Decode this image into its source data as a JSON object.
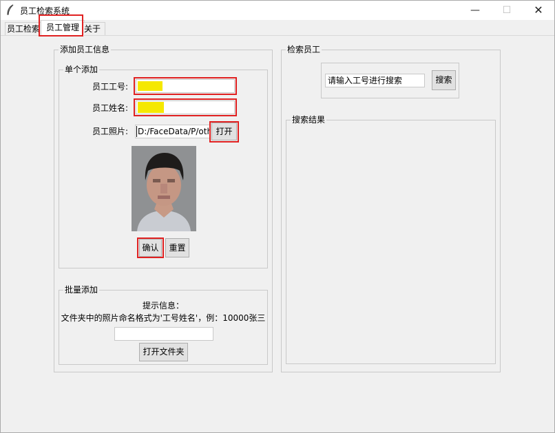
{
  "window": {
    "title": "员工检索系统",
    "app_icon": "feather-icon",
    "controls": {
      "minimize": "—",
      "maximize": "☐",
      "close": "✕"
    }
  },
  "tabs": [
    {
      "label": "员工检索"
    },
    {
      "label": "员工管理",
      "selected": true
    },
    {
      "label": "关于"
    }
  ],
  "add_section": {
    "title": "添加员工信息",
    "single": {
      "title": "单个添加",
      "id_label": "员工工号:",
      "id_value": "",
      "name_label": "员工姓名:",
      "name_value": "",
      "photo_label": "员工照片:",
      "photo_path": "D:/FaceData/P/oth",
      "open_button": "打开",
      "confirm_button": "确认",
      "reset_button": "重置"
    },
    "batch": {
      "title": "批量添加",
      "hint_title": "提示信息：",
      "hint_text": "文件夹中的照片命名格式为'工号姓名'，例：10000张三",
      "folder_value": "",
      "open_folder_button": "打开文件夹"
    }
  },
  "search_section": {
    "title": "检索员工",
    "search_value": "请输入工号进行搜索",
    "search_button": "搜索",
    "results_title": "搜索结果",
    "results": []
  },
  "colors": {
    "highlight_box": "#e02020",
    "text_highlight": "#f5e800"
  }
}
